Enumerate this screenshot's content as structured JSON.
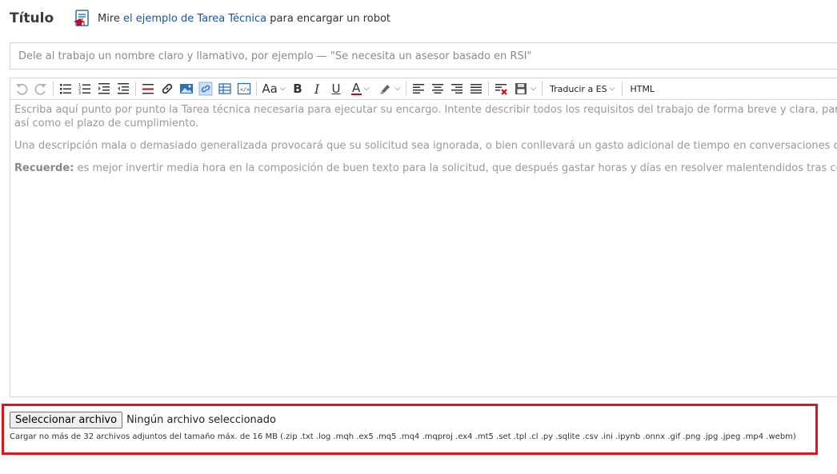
{
  "header": {
    "title": "Título",
    "hint_prefix": "Mire ",
    "hint_link": "el ejemplo de Tarea Técnica",
    "hint_suffix": " para encargar un robot"
  },
  "title_input": {
    "value": "",
    "placeholder": "Dele al trabajo un nombre claro y llamativo, por ejemplo — \"Se necesita un asesor basado en RSI\""
  },
  "toolbar": {
    "icons": [
      "undo-icon",
      "redo-icon",
      "bullet-list-icon",
      "numbered-list-icon",
      "indent-icon",
      "outdent-icon",
      "horizontal-rule-icon",
      "link-icon",
      "image-icon",
      "unlink-icon",
      "table-icon",
      "code-icon",
      "font-size-icon",
      "bold-icon",
      "italic-icon",
      "underline-icon",
      "font-color-icon",
      "highlight-icon",
      "align-left-icon",
      "align-center-icon",
      "align-right-icon",
      "justify-icon",
      "remove-format-icon",
      "save-template-icon"
    ],
    "font_size_label": "Aa",
    "bold_label": "B",
    "italic_label": "I",
    "underline_label": "U",
    "font_color_label": "A",
    "translate_label": "Traducir a ES",
    "html_label": "HTML"
  },
  "editor": {
    "line1": "Escriba aquí punto por punto la Tarea técnica necesaria para ejecutar su encargo. Intente describir todos los requisitos del trabajo de forma breve y clara, para que",
    "line2": "así como el plazo de cumplimiento.",
    "paragraph2": "Una descripción mala o demasiado generalizada provocará que su solicitud sea ignorada, o bien conllevará un gasto adicional de tiempo en conversaciones con cada",
    "remember_label": "Recuerde:",
    "paragraph3": " es mejor invertir media hora en la composición de buen texto para la solicitud, que después gastar horas y días en resolver malentendidos tras cerrar el"
  },
  "upload": {
    "button_label": "Seleccionar archivo",
    "status": "Ningún archivo seleccionado",
    "note": "Cargar no más de 32 archivos adjuntos del tamaño máx. de 16 MB (.zip .txt .log .mqh .ex5 .mq5 .mq4 .mqproj .ex4 .mt5 .set .tpl .cl .py .sqlite .csv .ini .ipynb .onnx .gif .png .jpg .jpeg .mp4 .webm)"
  },
  "colors": {
    "link": "#1c55a3",
    "highlight_border": "#e0141b",
    "font_color_bar": "#d0021b",
    "icon_blue": "#2f6fba"
  }
}
